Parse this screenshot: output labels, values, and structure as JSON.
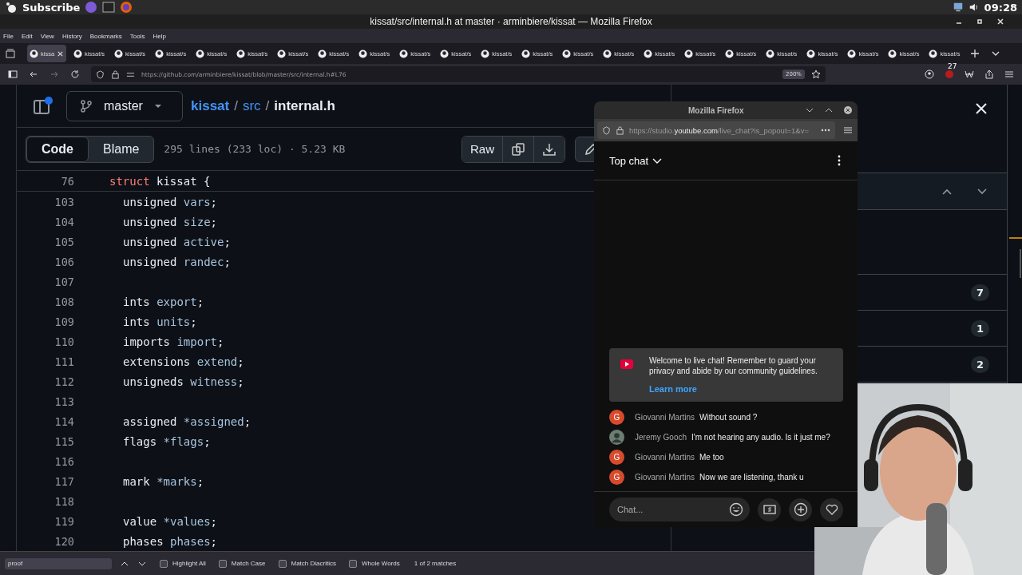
{
  "system_bar": {
    "label": "Subscribe",
    "time": "09:28"
  },
  "window": {
    "title": "kissat/src/internal.h at master · arminbiere/kissat — Mozilla Firefox"
  },
  "menu": [
    "File",
    "Edit",
    "View",
    "History",
    "Bookmarks",
    "Tools",
    "Help"
  ],
  "tabs": [
    {
      "label": "kissa",
      "selected": true
    },
    {
      "label": "kissat/s",
      "selected": false
    },
    {
      "label": "kissat/s",
      "selected": false
    },
    {
      "label": "kissat/s",
      "selected": false
    },
    {
      "label": "kissat/s",
      "selected": false
    },
    {
      "label": "kissat/s",
      "selected": false
    },
    {
      "label": "kissat/s",
      "selected": false
    },
    {
      "label": "kissat/s",
      "selected": false
    },
    {
      "label": "kissat/s",
      "selected": false
    },
    {
      "label": "kissat/s",
      "selected": false
    },
    {
      "label": "kissat/s",
      "selected": false
    },
    {
      "label": "kissat/s",
      "selected": false
    },
    {
      "label": "kissat/s",
      "selected": false
    },
    {
      "label": "kissat/s",
      "selected": false
    },
    {
      "label": "kissat/s",
      "selected": false
    },
    {
      "label": "kissat/s",
      "selected": false
    },
    {
      "label": "kissat/s",
      "selected": false
    },
    {
      "label": "kissat/s",
      "selected": false
    },
    {
      "label": "kissat/s",
      "selected": false
    },
    {
      "label": "kissat/s",
      "selected": false
    },
    {
      "label": "kissat/s",
      "selected": false
    },
    {
      "label": "kissat/s",
      "selected": false
    },
    {
      "label": "kissat/s",
      "selected": false
    }
  ],
  "nav": {
    "url": "https://github.com/arminbiere/kissat/blob/master/src/internal.h#L76",
    "zoom": "200%",
    "extension_badge": "27"
  },
  "file_header": {
    "branch": "master",
    "path": [
      "kissat",
      "src"
    ],
    "separator": "/",
    "file": "internal.h"
  },
  "view_tabs": [
    {
      "label": "Code",
      "selected": true
    },
    {
      "label": "Blame",
      "selected": false
    }
  ],
  "file_info": "295 lines (233 loc) · 5.23 KB",
  "raw_button": "Raw",
  "sticky_line": {
    "number": "76",
    "tokens": [
      {
        "kind": "keyword",
        "text": "struct"
      },
      {
        "kind": "plain",
        "text": " kissat {"
      }
    ]
  },
  "lines": [
    {
      "number": "103",
      "tokens": [
        {
          "kind": "plain",
          "text": "unsigned "
        },
        {
          "kind": "ident",
          "text": "vars"
        },
        {
          "kind": "plain",
          "text": ";"
        }
      ]
    },
    {
      "number": "104",
      "tokens": [
        {
          "kind": "plain",
          "text": "unsigned "
        },
        {
          "kind": "ident",
          "text": "size"
        },
        {
          "kind": "plain",
          "text": ";"
        }
      ]
    },
    {
      "number": "105",
      "tokens": [
        {
          "kind": "plain",
          "text": "unsigned "
        },
        {
          "kind": "ident",
          "text": "active"
        },
        {
          "kind": "plain",
          "text": ";"
        }
      ]
    },
    {
      "number": "106",
      "tokens": [
        {
          "kind": "plain",
          "text": "unsigned "
        },
        {
          "kind": "ident",
          "text": "randec"
        },
        {
          "kind": "plain",
          "text": ";"
        }
      ]
    },
    {
      "number": "107"
    },
    {
      "number": "108",
      "tokens": [
        {
          "kind": "plain",
          "text": "ints "
        },
        {
          "kind": "ident",
          "text": "export"
        },
        {
          "kind": "plain",
          "text": ";"
        }
      ]
    },
    {
      "number": "109",
      "tokens": [
        {
          "kind": "plain",
          "text": "ints "
        },
        {
          "kind": "ident",
          "text": "units"
        },
        {
          "kind": "plain",
          "text": ";"
        }
      ]
    },
    {
      "number": "110",
      "tokens": [
        {
          "kind": "plain",
          "text": "imports "
        },
        {
          "kind": "ident",
          "text": "import"
        },
        {
          "kind": "plain",
          "text": ";"
        }
      ]
    },
    {
      "number": "111",
      "tokens": [
        {
          "kind": "plain",
          "text": "extensions "
        },
        {
          "kind": "ident",
          "text": "extend"
        },
        {
          "kind": "plain",
          "text": ";"
        }
      ]
    },
    {
      "number": "112",
      "tokens": [
        {
          "kind": "plain",
          "text": "unsigneds "
        },
        {
          "kind": "ident",
          "text": "witness"
        },
        {
          "kind": "plain",
          "text": ";"
        }
      ]
    },
    {
      "number": "113"
    },
    {
      "number": "114",
      "tokens": [
        {
          "kind": "plain",
          "text": "assigned "
        },
        {
          "kind": "ident",
          "text": "*assigned"
        },
        {
          "kind": "plain",
          "text": ";"
        }
      ]
    },
    {
      "number": "115",
      "tokens": [
        {
          "kind": "plain",
          "text": "flags "
        },
        {
          "kind": "ident",
          "text": "*flags"
        },
        {
          "kind": "plain",
          "text": ";"
        }
      ]
    },
    {
      "number": "116"
    },
    {
      "number": "117",
      "tokens": [
        {
          "kind": "plain",
          "text": "mark "
        },
        {
          "kind": "ident",
          "text": "*marks"
        },
        {
          "kind": "plain",
          "text": ";"
        }
      ]
    },
    {
      "number": "118"
    },
    {
      "number": "119",
      "tokens": [
        {
          "kind": "plain",
          "text": "value "
        },
        {
          "kind": "ident",
          "text": "*values"
        },
        {
          "kind": "plain",
          "text": ";"
        }
      ]
    },
    {
      "number": "120",
      "tokens": [
        {
          "kind": "plain",
          "text": "phases "
        },
        {
          "kind": "ident",
          "text": "phases"
        },
        {
          "kind": "plain",
          "text": ";"
        }
      ]
    }
  ],
  "side_panel": {
    "counts": [
      "7",
      "1",
      "2"
    ]
  },
  "chat_window": {
    "title": "Mozilla Firefox",
    "url_pre": "https://studio.",
    "url_host": "youtube.com",
    "url_post": "/live_chat?is_popout=1&v=",
    "header": "Top chat",
    "welcome": "Welcome to live chat! Remember to guard your privacy and abide by our community guidelines.",
    "learn_more": "Learn more",
    "messages": [
      {
        "avatar": {
          "kind": "letter",
          "letter": "G",
          "color": "#d84a2c"
        },
        "author": "Giovanni Martins",
        "text": "Without sound ?"
      },
      {
        "author": "Jeremy Gooch",
        "text": "I'm not hearing any audio. Is it just me?"
      },
      {
        "avatar": {
          "kind": "letter",
          "letter": "G",
          "color": "#d84a2c"
        },
        "author": "Giovanni Martins",
        "text": "Me too"
      },
      {
        "avatar": {
          "kind": "letter",
          "letter": "G",
          "color": "#d84a2c"
        },
        "author": "Giovanni Martins",
        "text": "Now we are listening, thank u"
      }
    ],
    "input_placeholder": "Chat..."
  },
  "find_bar": {
    "value": "proof",
    "options": [
      {
        "label": "Highlight All",
        "checked": false
      },
      {
        "label": "Match Case",
        "checked": false
      },
      {
        "label": "Match Diacritics",
        "checked": false
      },
      {
        "label": "Whole Words",
        "checked": false
      }
    ],
    "result": "1 of 2 matches"
  }
}
